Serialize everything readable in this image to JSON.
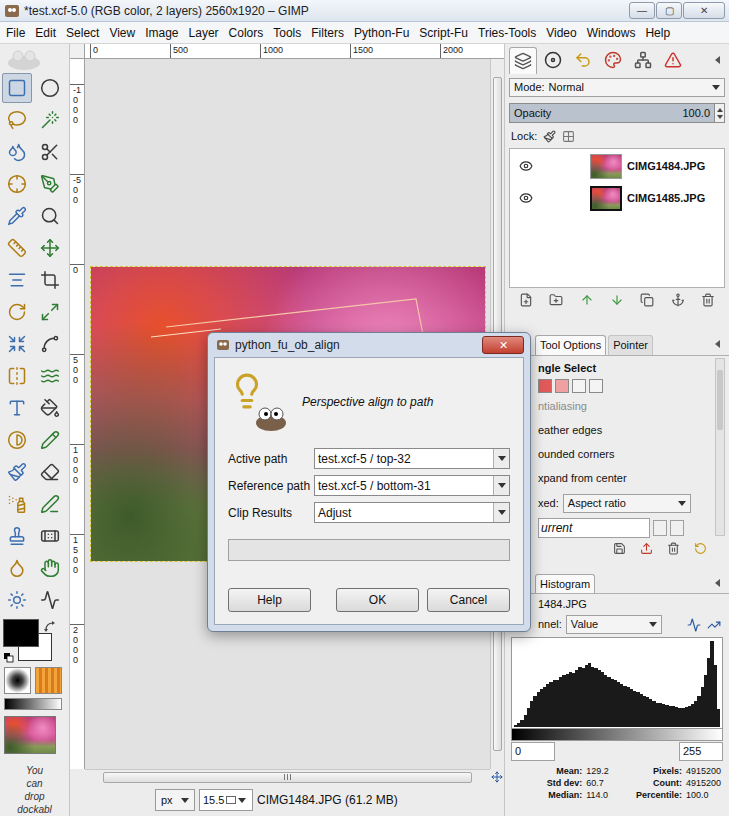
{
  "window": {
    "title": "*test.xcf-5.0 (RGB color, 2 layers) 2560x1920 – GIMP",
    "controls": [
      "—",
      "▢",
      "✕"
    ]
  },
  "menu": [
    "File",
    "Edit",
    "Select",
    "View",
    "Image",
    "Layer",
    "Colors",
    "Tools",
    "Filters",
    "Python-Fu",
    "Script-Fu",
    "Tries-Tools",
    "Video",
    "Windows",
    "Help"
  ],
  "toolbox": {
    "tools": [
      {
        "selected": true
      },
      {
        "selected": false
      },
      {
        "selected": false
      },
      {
        "selected": false
      },
      {
        "selected": false
      },
      {
        "selected": false
      },
      {
        "selected": false
      },
      {
        "selected": false
      },
      {
        "selected": false
      },
      {
        "selected": false
      },
      {
        "selected": false
      },
      {
        "selected": false
      },
      {
        "selected": false
      },
      {
        "selected": false
      },
      {
        "selected": false
      },
      {
        "selected": false
      },
      {
        "selected": false
      },
      {
        "selected": false
      },
      {
        "selected": false
      },
      {
        "selected": false
      },
      {
        "selected": false
      },
      {
        "selected": false
      },
      {
        "selected": false
      },
      {
        "selected": false
      },
      {
        "selected": false
      },
      {
        "selected": false
      },
      {
        "selected": false
      },
      {
        "selected": false
      },
      {
        "selected": false
      },
      {
        "selected": false
      },
      {
        "selected": false
      },
      {
        "selected": false
      },
      {
        "selected": false
      },
      {
        "selected": false
      }
    ],
    "foreground": {
      "color": "#000000"
    },
    "background": {
      "color": "#ffffff"
    },
    "hint": [
      "You",
      "can",
      "drop",
      "dockabl"
    ]
  },
  "rulers": {
    "top": [
      "0",
      "500",
      "1000",
      "1500",
      "2000"
    ],
    "left": [
      "-1000",
      "-500",
      "0",
      "500",
      "1000",
      "1500",
      "2000"
    ]
  },
  "status_bar": {
    "unit": "px",
    "zoom": "15.5",
    "info": "CIMG1484.JPG (61.2 MB)"
  },
  "layers_panel": {
    "tabs": [
      {
        "selected": true
      },
      {
        "selected": false
      },
      {
        "selected": false
      },
      {
        "selected": false
      },
      {
        "selected": false
      },
      {
        "selected": false
      }
    ],
    "mode_label": "Mode:",
    "mode": "Normal",
    "opacity_label": "Opacity",
    "opacity": "100.0",
    "opacity_level": 1,
    "lock_label": "Lock:",
    "layers": [
      {
        "name": "CIMG1484.JPG",
        "visible": true,
        "selected": false
      },
      {
        "name": "CIMG1485.JPG",
        "visible": true,
        "selected": true
      }
    ]
  },
  "tool_options": {
    "tabs": [
      {
        "label": "Tool Options",
        "selected": true
      },
      {
        "label": "Pointer",
        "selected": false
      }
    ],
    "title": "ngle Select",
    "options": [
      {
        "kind": "checkbox",
        "label": "ntialiasing",
        "disabled": true
      },
      {
        "kind": "checkbox",
        "label": "eather edges",
        "disabled": false
      },
      {
        "kind": "checkbox",
        "label": "ounded corners",
        "disabled": false
      },
      {
        "kind": "checkbox",
        "label": "xpand from center",
        "disabled": false
      },
      {
        "kind": "combo",
        "label": "xed:",
        "value": "Aspect ratio",
        "disabled": false
      },
      {
        "kind": "field",
        "value": "urrent",
        "disabled": false
      }
    ]
  },
  "histogram": {
    "tab": "Histogram",
    "layer": "1484.JPG",
    "channel_label": "nnel:",
    "channel": "Value",
    "values": [
      2,
      4,
      8,
      14,
      22,
      30,
      36,
      40,
      44,
      46,
      50,
      52,
      55,
      54,
      58,
      60,
      62,
      64,
      63,
      66,
      70,
      68,
      72,
      74,
      70,
      68,
      66,
      64,
      60,
      58,
      56,
      55,
      52,
      50,
      48,
      46,
      44,
      42,
      40,
      38,
      36,
      34,
      32,
      30,
      28,
      27,
      26,
      25,
      24,
      24,
      23,
      22,
      22,
      23,
      24,
      26,
      30,
      36,
      46,
      60,
      80,
      100,
      72,
      20
    ],
    "range_min": "0",
    "range_max": "255",
    "stats": [
      {
        "label": "Mean:",
        "value": "129.2"
      },
      {
        "label": "Pixels:",
        "value": "4915200"
      },
      {
        "label": "Std dev:",
        "value": "60.7"
      },
      {
        "label": "Count:",
        "value": "4915200"
      },
      {
        "label": "Median:",
        "value": "114.0"
      },
      {
        "label": "Percentile:",
        "value": "100.0"
      }
    ]
  },
  "dialog": {
    "title": "python_fu_ob_align",
    "close": "✕",
    "heading": "Perspective align to path",
    "fields": [
      {
        "label": "Active path",
        "value": "test.xcf-5 / top-32"
      },
      {
        "label": "Reference path",
        "value": "test.xcf-5 / bottom-31"
      },
      {
        "label": "Clip Results",
        "value": "Adjust"
      }
    ],
    "progress_level": 0,
    "buttons": [
      "Help",
      "OK",
      "Cancel"
    ]
  }
}
